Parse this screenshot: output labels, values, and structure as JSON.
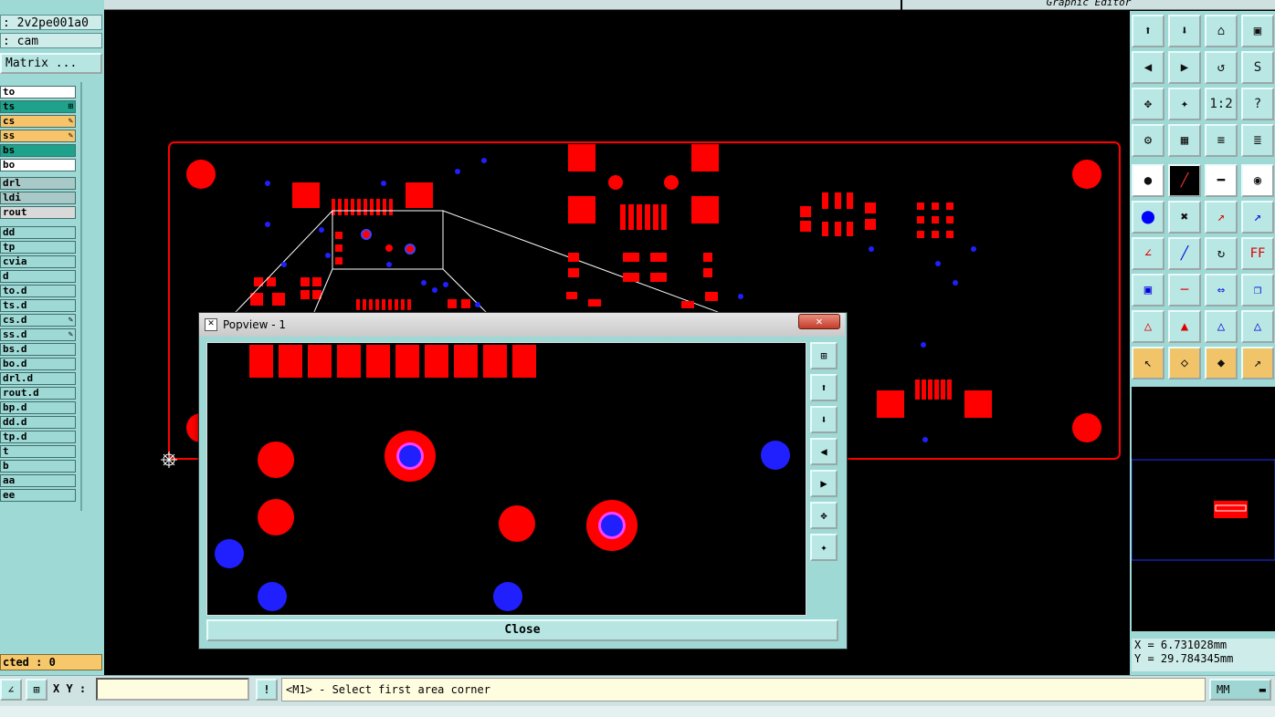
{
  "app": {
    "title": "Graphic Editor"
  },
  "left_panel": {
    "job_line": ": 2v2pe001a0",
    "step_line": ": cam",
    "matrix_button": "Matrix ...",
    "layers": [
      {
        "name": "to",
        "color": "#ffffff",
        "mark": ""
      },
      {
        "name": "ts",
        "color": "#1ea28b",
        "mark": "⊞"
      },
      {
        "name": "cs",
        "color": "#f7c46a",
        "mark": "✎"
      },
      {
        "name": "ss",
        "color": "#f7c46a",
        "mark": "✎"
      },
      {
        "name": "bs",
        "color": "#1ea28b",
        "mark": ""
      },
      {
        "name": "bo",
        "color": "#ffffff",
        "mark": ""
      },
      {
        "name": "drl",
        "color": "#a8c9c7",
        "mark": ""
      },
      {
        "name": "ldi",
        "color": "#a8c9c7",
        "mark": ""
      },
      {
        "name": "rout",
        "color": "#d9d9d9",
        "mark": ""
      },
      {
        "name": "dd",
        "color": "#9ed9d6",
        "mark": ""
      },
      {
        "name": "tp",
        "color": "#9ed9d6",
        "mark": ""
      },
      {
        "name": "cvia",
        "color": "#9ed9d6",
        "mark": ""
      },
      {
        "name": "d",
        "color": "#9ed9d6",
        "mark": ""
      },
      {
        "name": "to.d",
        "color": "#9ed9d6",
        "mark": ""
      },
      {
        "name": "ts.d",
        "color": "#9ed9d6",
        "mark": ""
      },
      {
        "name": "cs.d",
        "color": "#9ed9d6",
        "mark": "✎"
      },
      {
        "name": "ss.d",
        "color": "#9ed9d6",
        "mark": "✎"
      },
      {
        "name": "bs.d",
        "color": "#9ed9d6",
        "mark": ""
      },
      {
        "name": "bo.d",
        "color": "#9ed9d6",
        "mark": ""
      },
      {
        "name": "drl.d",
        "color": "#9ed9d6",
        "mark": ""
      },
      {
        "name": "rout.d",
        "color": "#9ed9d6",
        "mark": ""
      },
      {
        "name": "bp.d",
        "color": "#9ed9d6",
        "mark": ""
      },
      {
        "name": "dd.d",
        "color": "#9ed9d6",
        "mark": ""
      },
      {
        "name": "tp.d",
        "color": "#9ed9d6",
        "mark": ""
      },
      {
        "name": "t",
        "color": "#9ed9d6",
        "mark": ""
      },
      {
        "name": "b",
        "color": "#9ed9d6",
        "mark": ""
      },
      {
        "name": "aa",
        "color": "#9ed9d6",
        "mark": ""
      },
      {
        "name": "ee",
        "color": "#9ed9d6",
        "mark": ""
      }
    ],
    "selected_text": "cted : 0"
  },
  "popview": {
    "title": "Popview - 1",
    "close_x": "✕",
    "close_button": "Close",
    "side_tools": [
      "zoom-window",
      "pan-up",
      "pan-down",
      "pan-left",
      "pan-right",
      "zoom-fit",
      "zoom-home"
    ]
  },
  "coords": {
    "x_label": "X = 6.731028mm",
    "y_label": "Y = 29.784345mm"
  },
  "bottom": {
    "xy_label": "X Y :",
    "xy_value": "",
    "alert_icon": "!",
    "message": "<M1> - Select first area corner",
    "units": "MM",
    "status_strip": "                                                               "
  },
  "colors": {
    "board_red": "#ff0000",
    "via_blue": "#1a1aff",
    "panel_teal": "#9ed9d6",
    "highlight_orange": "#f2c46a"
  }
}
